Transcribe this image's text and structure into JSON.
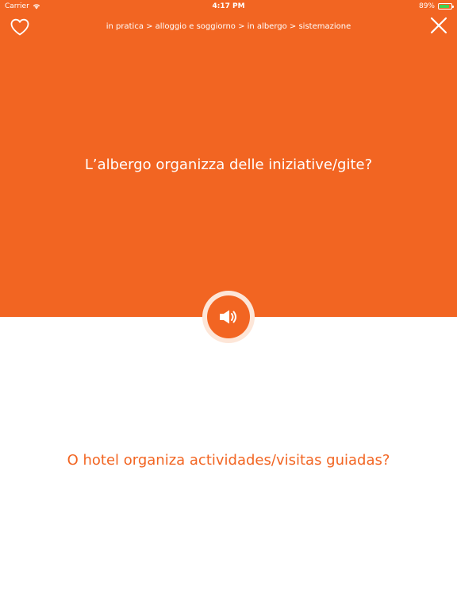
{
  "status_bar": {
    "carrier": "Carrier",
    "time": "4:17 PM",
    "battery": "89%",
    "battery_level": 0.89,
    "wifi_icon": "wifi-icon",
    "battery_icon": "battery-icon"
  },
  "header": {
    "favorite_icon": "heart-icon",
    "breadcrumb": "in pratica > alloggio e soggiorno > in albergo > sistemazione",
    "close_icon": "close-icon"
  },
  "content": {
    "source_phrase": "L’albergo organizza delle iniziative/gite?",
    "audio_icon": "speaker-icon",
    "target_phrase": "O hotel organiza actividades/visitas guiadas?"
  },
  "colors": {
    "accent": "#f26522",
    "audio_ring": "#fde6d8",
    "white": "#ffffff",
    "battery_fill": "#43d34f"
  }
}
